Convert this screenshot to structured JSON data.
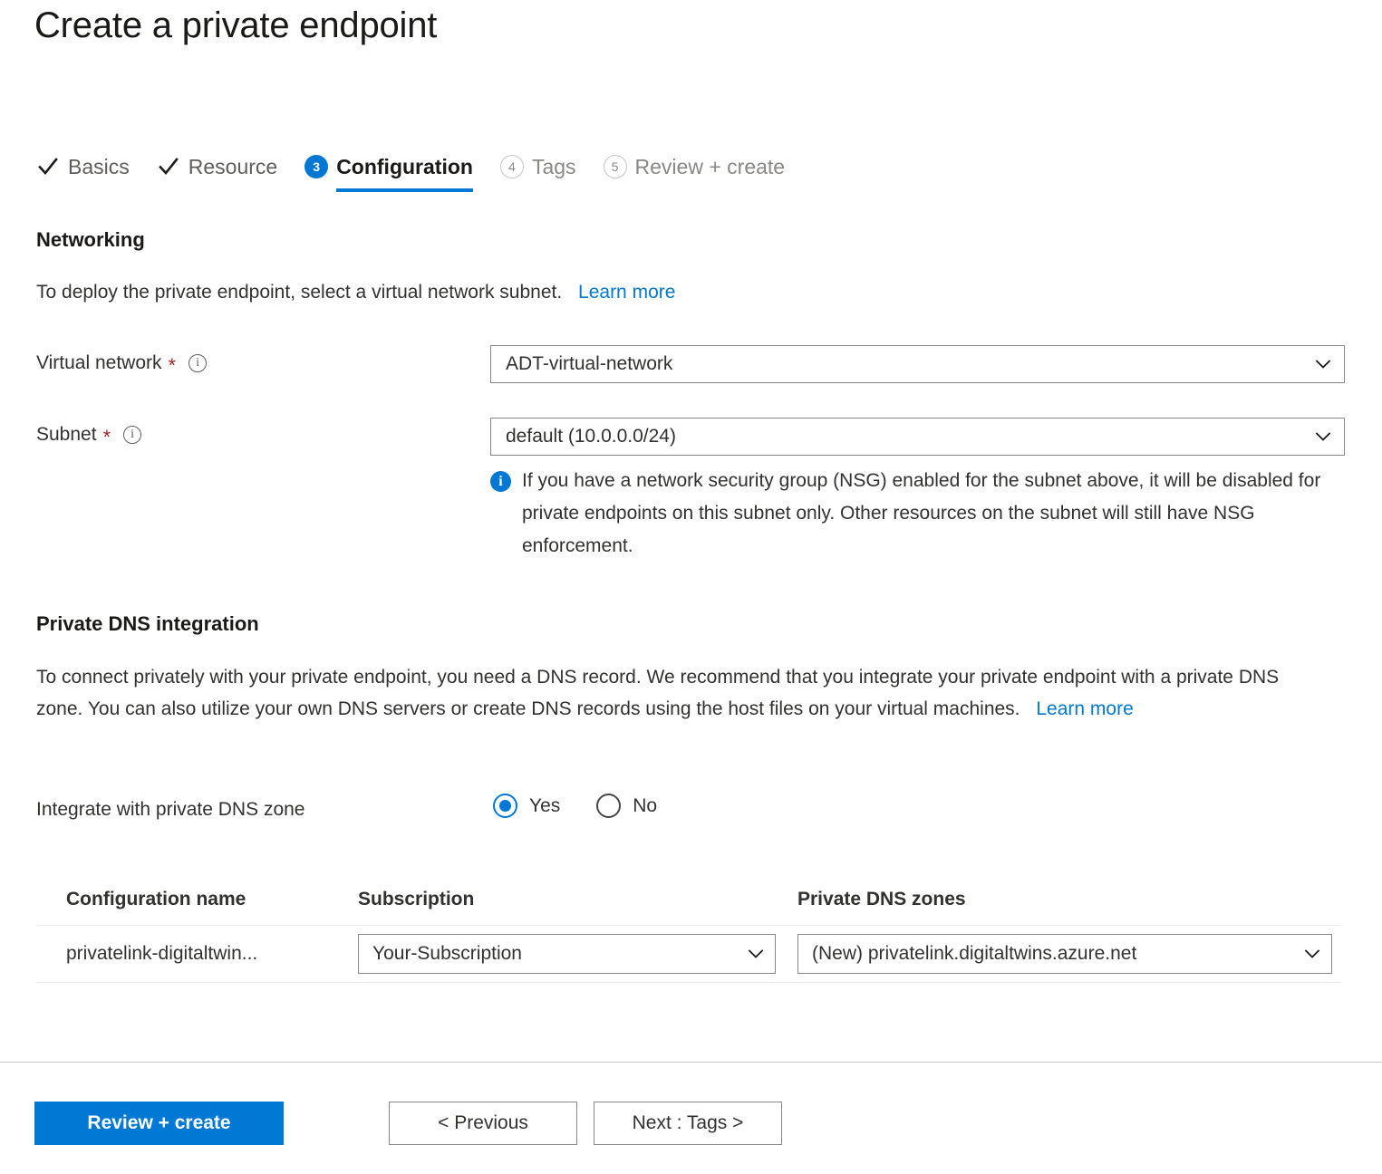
{
  "page": {
    "title": "Create a private endpoint"
  },
  "wizard": {
    "tabs": [
      {
        "label": "Basics",
        "state": "done",
        "marker": "check-icon"
      },
      {
        "label": "Resource",
        "state": "done",
        "marker": "check-icon"
      },
      {
        "label": "Configuration",
        "state": "active",
        "marker": "3"
      },
      {
        "label": "Tags",
        "state": "upcoming",
        "marker": "4"
      },
      {
        "label": "Review + create",
        "state": "upcoming",
        "marker": "5"
      }
    ]
  },
  "networking": {
    "heading": "Networking",
    "description": "To deploy the private endpoint, select a virtual network subnet.",
    "learn_more": "Learn more",
    "virtual_network": {
      "label": "Virtual network",
      "required_mark": "*",
      "value": "ADT-virtual-network"
    },
    "subnet": {
      "label": "Subnet",
      "required_mark": "*",
      "value": "default (10.0.0.0/24)"
    },
    "nsg_note": "If you have a network security group (NSG) enabled for the subnet above, it will be disabled for private endpoints on this subnet only. Other resources on the subnet will still have NSG enforcement."
  },
  "private_dns": {
    "heading": "Private DNS integration",
    "description": "To connect privately with your private endpoint, you need a DNS record. We recommend that you integrate your private endpoint with a private DNS zone. You can also utilize your own DNS servers or create DNS records using the host files on your virtual machines.",
    "learn_more": "Learn more",
    "integrate_label": "Integrate with private DNS zone",
    "radio_options": [
      {
        "label": "Yes",
        "selected": true
      },
      {
        "label": "No",
        "selected": false
      }
    ],
    "table": {
      "headers": {
        "configuration_name": "Configuration name",
        "subscription": "Subscription",
        "private_dns_zones": "Private DNS zones"
      },
      "rows": [
        {
          "configuration_name": "privatelink-digitaltwin...",
          "subscription": "Your-Subscription",
          "private_dns_zone": "(New) privatelink.digitaltwins.azure.net"
        }
      ]
    }
  },
  "footer": {
    "review_create": "Review + create",
    "previous": "< Previous",
    "next": "Next : Tags >"
  },
  "colors": {
    "accent": "#0078d4",
    "required": "#a4262c",
    "text": "#323130",
    "muted": "#8a8886",
    "border": "#8a8886"
  }
}
